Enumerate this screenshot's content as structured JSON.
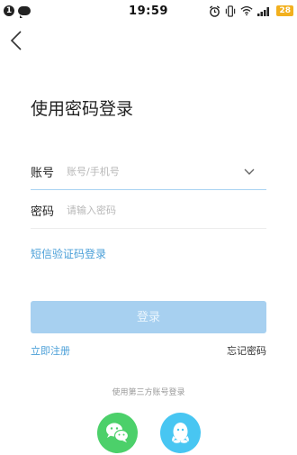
{
  "status_bar": {
    "notification_count": "1",
    "time": "19:59",
    "battery": "28"
  },
  "login": {
    "title": "使用密码登录",
    "account_label": "账号",
    "account_placeholder": "账号/手机号",
    "password_label": "密码",
    "password_placeholder": "请输入密码",
    "sms_login_link": "短信验证码登录",
    "login_button": "登录",
    "register_link": "立即注册",
    "forgot_password_link": "忘记密码",
    "third_party_label": "使用第三方账号登录"
  },
  "icons": {
    "back": "back-arrow-icon",
    "dropdown": "chevron-down-icon",
    "wechat": "wechat-icon",
    "qq": "qq-icon"
  },
  "colors": {
    "accent": "#4a9fd8",
    "login_button_bg": "#a7d0f0",
    "wechat": "#4cd06a",
    "qq": "#48c6f2",
    "battery": "#f2b01e"
  }
}
